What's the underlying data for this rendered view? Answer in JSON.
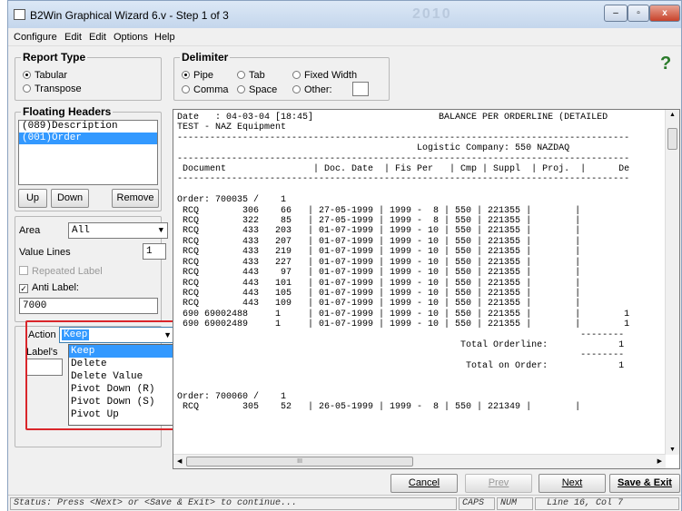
{
  "window": {
    "title": "B2Win Graphical Wizard 6.v - Step 1 of 3",
    "watermark": "2010",
    "min": "–",
    "max": "▫",
    "close": "x"
  },
  "menu": [
    "Configure",
    "Edit",
    "Edit",
    "Options",
    "Help"
  ],
  "report_type": {
    "title": "Report Type",
    "options": [
      {
        "label": "Tabular",
        "selected": true
      },
      {
        "label": "Transpose",
        "selected": false
      }
    ]
  },
  "delimiter": {
    "title": "Delimiter",
    "options": [
      {
        "label": "Pipe",
        "selected": true
      },
      {
        "label": "Tab",
        "selected": false
      },
      {
        "label": "Fixed Width",
        "selected": false
      },
      {
        "label": "Comma",
        "selected": false
      },
      {
        "label": "Space",
        "selected": false
      },
      {
        "label": "Other:",
        "selected": false
      }
    ],
    "other_value": ""
  },
  "help_glyph": "?",
  "floating_headers": {
    "title": "Floating Headers",
    "items": [
      "(089)Description",
      "(001)Order"
    ],
    "selected_index": 1,
    "up": "Up",
    "down": "Down",
    "remove": "Remove"
  },
  "area": {
    "label": "Area",
    "value": "All"
  },
  "value_lines": {
    "label": "Value Lines",
    "value": "1"
  },
  "repeated_label": {
    "label": "Repeated Label",
    "checked": false
  },
  "anti_label": {
    "label": "Anti Label:",
    "checked": true,
    "value": "7000"
  },
  "action": {
    "label": "Action",
    "value": "Keep",
    "options": [
      "Keep",
      "Delete",
      "Delete Value",
      "Pivot Down (R)",
      "Pivot Down (S)",
      "Pivot Up"
    ],
    "selected_index": 0
  },
  "labels_label": "Label's",
  "report_lines": [
    "Date   : 04-03-04 [18:45]                       BALANCE PER ORDERLINE (DETAILED",
    "TEST - NAZ Equipment",
    "-----------------------------------------------------------------------------------",
    "                                            Logistic Company: 550 NAZDAQ",
    "-----------------------------------------------------------------------------------",
    " Document                | Doc. Date  | Fis Per   | Cmp | Suppl  | Proj.  |      De",
    "-----------------------------------------------------------------------------------",
    "",
    "Order: 700035 /    1",
    " RCQ        306    66   | 27-05-1999 | 1999 -  8 | 550 | 221355 |        |",
    " RCQ        322    85   | 27-05-1999 | 1999 -  8 | 550 | 221355 |        |",
    " RCQ        433   203   | 01-07-1999 | 1999 - 10 | 550 | 221355 |        |",
    " RCQ        433   207   | 01-07-1999 | 1999 - 10 | 550 | 221355 |        |",
    " RCQ        433   219   | 01-07-1999 | 1999 - 10 | 550 | 221355 |        |",
    " RCQ        433   227   | 01-07-1999 | 1999 - 10 | 550 | 221355 |        |",
    " RCQ        443    97   | 01-07-1999 | 1999 - 10 | 550 | 221355 |        |",
    " RCQ        443   101   | 01-07-1999 | 1999 - 10 | 550 | 221355 |        |",
    " RCQ        443   105   | 01-07-1999 | 1999 - 10 | 550 | 221355 |        |",
    " RCQ        443   109   | 01-07-1999 | 1999 - 10 | 550 | 221355 |        |",
    " 690 69002488     1     | 01-07-1999 | 1999 - 10 | 550 | 221355 |        |        1",
    " 690 69002489     1     | 01-07-1999 | 1999 - 10 | 550 | 221355 |        |        1",
    "                                                                          --------",
    "                                                    Total Orderline:             1",
    "                                                                          --------",
    "                                                     Total on Order:             1",
    "",
    "",
    "Order: 700060 /    1",
    " RCQ        305    52   | 26-05-1999 | 1999 -  8 | 550 | 221349 |        |"
  ],
  "hscroll_mark": "III",
  "buttons": {
    "cancel": "Cancel",
    "prev": "Prev",
    "next": "Next",
    "save_exit": "Save & Exit"
  },
  "status": {
    "text": "Status: Press <Next> or <Save & Exit> to continue...",
    "caps": "CAPS",
    "num": "NUM",
    "pos": "Line 16, Col 7"
  }
}
